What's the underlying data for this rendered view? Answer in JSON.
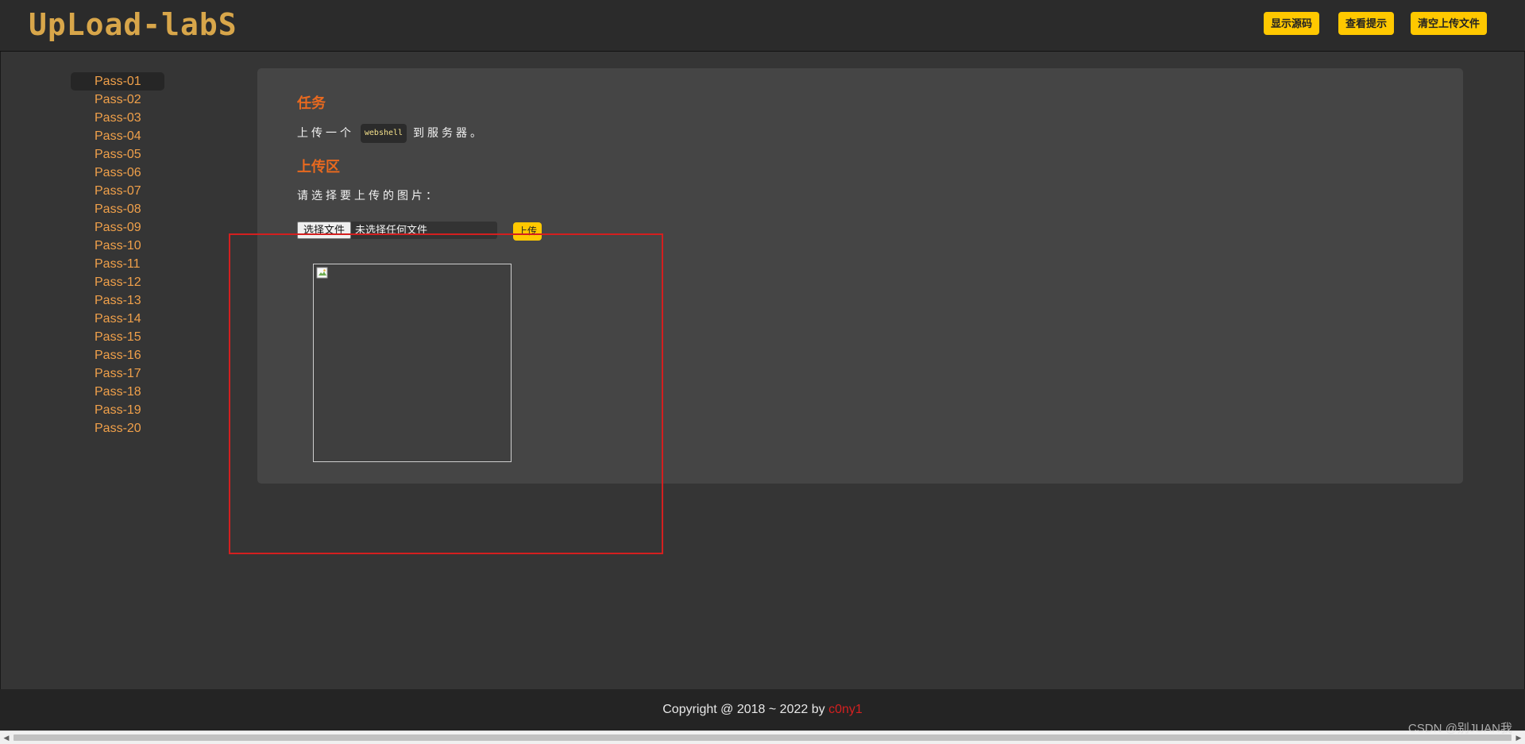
{
  "header": {
    "logo_text": "UpLoad-labS",
    "buttons": {
      "show_source": "显示源码",
      "view_hint": "查看提示",
      "clear_uploads": "清空上传文件"
    }
  },
  "sidebar": {
    "items": [
      {
        "label": "Pass-01",
        "active": true
      },
      {
        "label": "Pass-02"
      },
      {
        "label": "Pass-03"
      },
      {
        "label": "Pass-04"
      },
      {
        "label": "Pass-05"
      },
      {
        "label": "Pass-06"
      },
      {
        "label": "Pass-07"
      },
      {
        "label": "Pass-08"
      },
      {
        "label": "Pass-09"
      },
      {
        "label": "Pass-10"
      },
      {
        "label": "Pass-11"
      },
      {
        "label": "Pass-12"
      },
      {
        "label": "Pass-13"
      },
      {
        "label": "Pass-14"
      },
      {
        "label": "Pass-15"
      },
      {
        "label": "Pass-16"
      },
      {
        "label": "Pass-17"
      },
      {
        "label": "Pass-18"
      },
      {
        "label": "Pass-19"
      },
      {
        "label": "Pass-20"
      }
    ]
  },
  "main": {
    "task_title": "任务",
    "task_text_before": "上传一个",
    "task_code": "webshell",
    "task_text_after": "到服务器。",
    "upload_title": "上传区",
    "choose_label": "请选择要上传的图片：",
    "file_button": "选择文件",
    "file_status": "未选择任何文件",
    "upload_button": "上传"
  },
  "footer": {
    "copyright": "Copyright @ 2018 ~ 2022 by ",
    "author": "c0ny1"
  },
  "watermark": "CSDN @别JUAN我",
  "colors": {
    "accent_yellow": "#ffc800",
    "title_orange": "#e8691f",
    "sidebar_link": "#f0a04a",
    "highlight_red": "#d41f1f"
  }
}
